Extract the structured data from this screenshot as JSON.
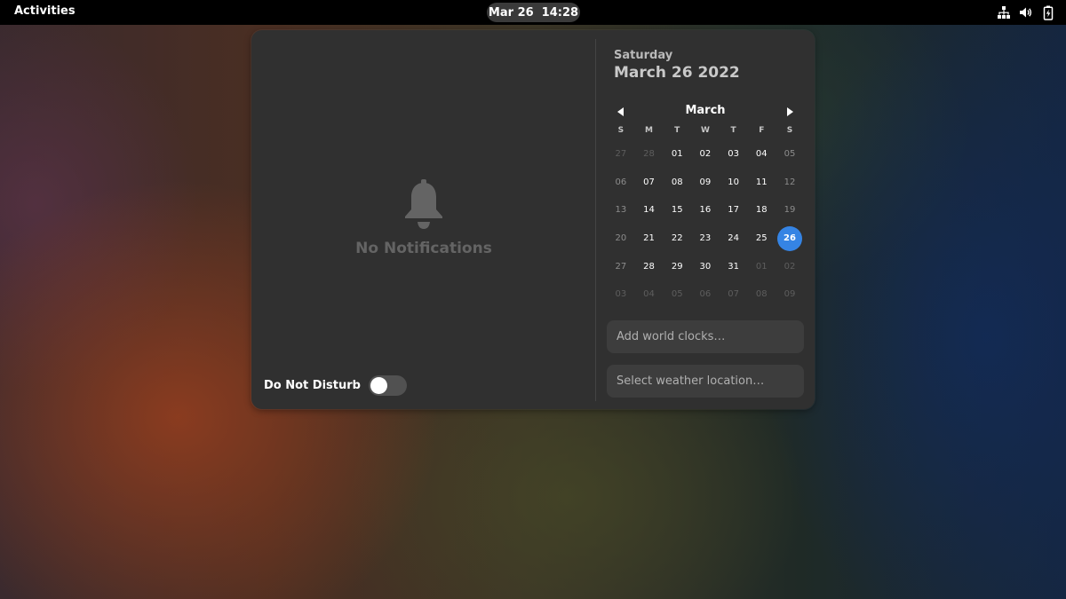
{
  "topbar": {
    "activities_label": "Activities",
    "clock_date": "Mar 26",
    "clock_time": "14:28",
    "tray_icons": [
      "network-icon",
      "volume-icon",
      "battery-icon"
    ]
  },
  "notifications": {
    "empty_label": "No Notifications",
    "dnd_label": "Do Not Disturb",
    "dnd_enabled": false
  },
  "calendar": {
    "weekday": "Saturday",
    "full_date": "March 26 2022",
    "month_label": "March",
    "day_headers": [
      "S",
      "M",
      "T",
      "W",
      "T",
      "F",
      "S"
    ],
    "weeks": [
      [
        "27",
        "28",
        "01",
        "02",
        "03",
        "04",
        "05"
      ],
      [
        "06",
        "07",
        "08",
        "09",
        "10",
        "11",
        "12"
      ],
      [
        "13",
        "14",
        "15",
        "16",
        "17",
        "18",
        "19"
      ],
      [
        "20",
        "21",
        "22",
        "23",
        "24",
        "25",
        "26"
      ],
      [
        "27",
        "28",
        "29",
        "30",
        "31",
        "01",
        "02"
      ],
      [
        "03",
        "04",
        "05",
        "06",
        "07",
        "08",
        "09"
      ]
    ],
    "today_label": "26",
    "accent_color": "#3584e4"
  },
  "buttons": {
    "world_clocks": "Add world clocks…",
    "weather": "Select weather location…"
  }
}
